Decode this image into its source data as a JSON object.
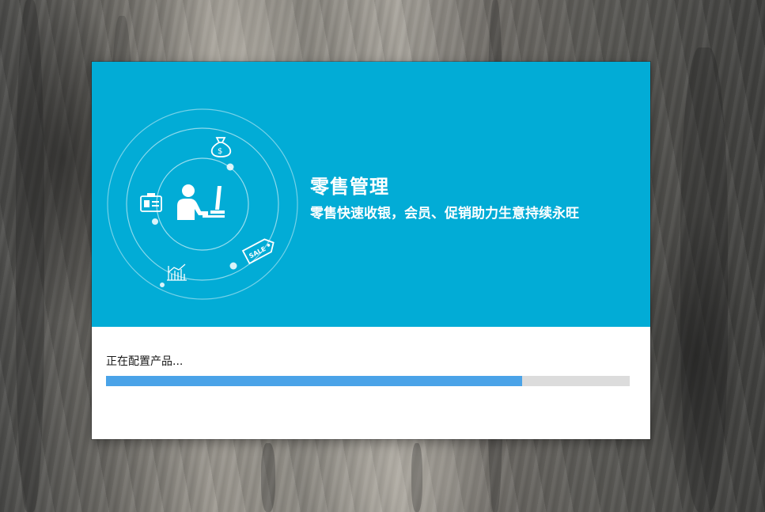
{
  "installer": {
    "title": "零售管理",
    "subtitle": "零售快速收银，会员、促销助力生意持续永旺",
    "status_text": "正在配置产品...",
    "progress": 0.795,
    "icons": [
      "cashier-person-icon",
      "money-bag-icon",
      "id-card-icon",
      "sale-tag-icon",
      "bar-chart-icon"
    ],
    "colors": {
      "banner": "#02acd6",
      "progress_fill": "#4aa3e8",
      "progress_track": "#dcdcdc"
    }
  }
}
